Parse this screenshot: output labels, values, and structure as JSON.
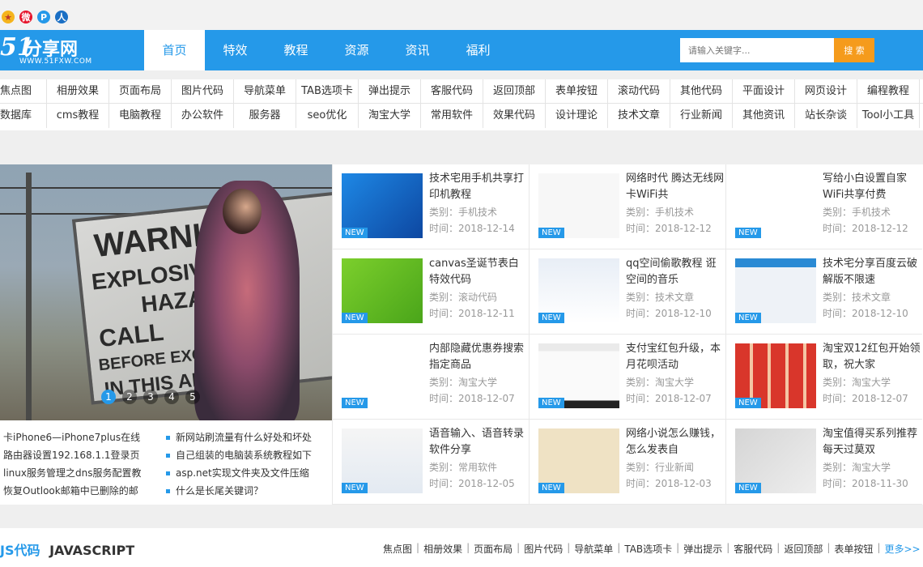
{
  "top_icons": [
    {
      "name": "star-icon",
      "color": "#f5b41c"
    },
    {
      "name": "weibo-icon",
      "color": "#e6162d"
    },
    {
      "name": "pinterest-icon",
      "color": "#2599e9"
    },
    {
      "name": "user-icon",
      "color": "#1a6fc4"
    }
  ],
  "logo": {
    "name": "分享网",
    "sub": "WWW.51FXW.COM"
  },
  "nav": {
    "items": [
      "首页",
      "特效",
      "教程",
      "资源",
      "资讯",
      "福利"
    ],
    "active": "首页"
  },
  "search": {
    "placeholder": "请输入关键字...",
    "button": "搜 索"
  },
  "tags": {
    "row1": [
      "焦点图",
      "相册效果",
      "页面布局",
      "图片代码",
      "导航菜单",
      "TAB选项卡",
      "弹出提示",
      "客服代码",
      "返回顶部",
      "表单按钮",
      "滚动代码",
      "其他代码",
      "平面设计",
      "网页设计",
      "编程教程"
    ],
    "row2": [
      "数据库",
      "cms教程",
      "电脑教程",
      "办公软件",
      "服务器",
      "seo优化",
      "淘宝大学",
      "常用软件",
      "效果代码",
      "设计理论",
      "技术文章",
      "行业新闻",
      "其他资讯",
      "站长杂谈",
      "Tool小工具"
    ]
  },
  "slider": {
    "dots": [
      "1",
      "2",
      "3",
      "4",
      "5"
    ],
    "active": 1,
    "sign_lines": [
      "WARNIN",
      "EXPLOSIV",
      "HAZA",
      "CALL",
      "BEFORE EXCAVA",
      "IN THIS AR"
    ]
  },
  "news_left": [
    "卡iPhone6—iPhone7plus在线",
    "路由器设置192.168.1.1登录页",
    "linux服务管理之dns服务配置教",
    "恢复Outlook邮箱中已删除的邮"
  ],
  "news_right": [
    "新网站刷流量有什么好处和坏处",
    "自己组装的电脑装系统教程如下",
    "asp.net实现文件夹及文件压缩",
    "什么是长尾关键词？"
  ],
  "badge_label": "NEW",
  "cards": [
    {
      "title": "技术宅用手机共享打印机教程",
      "category": "类别：手机技术",
      "time": "时间：2018-12-14"
    },
    {
      "title": "网络时代 腾达无线网卡WiFi共",
      "category": "类别：手机技术",
      "time": "时间：2018-12-12"
    },
    {
      "title": "写给小白设置自家WiFi共享付费",
      "category": "类别：手机技术",
      "time": "时间：2018-12-12"
    },
    {
      "title": "canvas圣诞节表白特效代码",
      "category": "类别：滚动代码",
      "time": "时间：2018-12-11"
    },
    {
      "title": "qq空间偷歌教程 诳空间的音乐",
      "category": "类别：技术文章",
      "time": "时间：2018-12-10"
    },
    {
      "title": "技术宅分享百度云破解版不限速",
      "category": "类别：技术文章",
      "time": "时间：2018-12-10"
    },
    {
      "title": "内部隐藏优惠券搜索指定商品",
      "category": "类别：淘宝大学",
      "time": "时间：2018-12-07"
    },
    {
      "title": "支付宝红包升级，本月花呗活动",
      "category": "类别：淘宝大学",
      "time": "时间：2018-12-07"
    },
    {
      "title": "淘宝双12红包开始领取，祝大家",
      "category": "类别：淘宝大学",
      "time": "时间：2018-12-07"
    },
    {
      "title": "语音输入、语音转录软件分享",
      "category": "类别：常用软件",
      "time": "时间：2018-12-05"
    },
    {
      "title": "网络小说怎么赚钱，怎么发表自",
      "category": "类别：行业新闻",
      "time": "时间：2018-12-03"
    },
    {
      "title": "淘宝值得买系列推荐每天过莫双",
      "category": "类别：淘宝大学",
      "time": "时间：2018-11-30"
    }
  ],
  "bottom": {
    "title_hl": "JS代码",
    "title_rest": "JAVASCRIPT",
    "links": [
      "焦点图",
      "相册效果",
      "页面布局",
      "图片代码",
      "导航菜单",
      "TAB选项卡",
      "弹出提示",
      "客服代码",
      "返回顶部",
      "表单按钮"
    ],
    "more": "更多>>"
  }
}
